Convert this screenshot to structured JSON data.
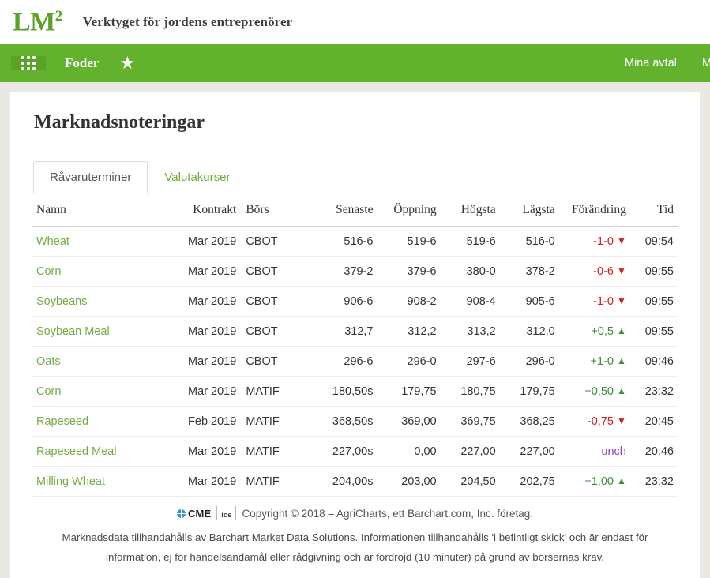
{
  "brand": {
    "logo_text": "LM",
    "logo_sup": "2",
    "tagline": "Verktyget för jordens entreprenörer"
  },
  "nav": {
    "grid_icon": "grid-apps-icon",
    "title": "Foder",
    "star_icon": "star-icon",
    "star_glyph": "★",
    "links": [
      {
        "label": "Mina avtal"
      },
      {
        "label": "M"
      }
    ]
  },
  "main": {
    "title": "Marknadsnoteringar",
    "tabs": [
      {
        "label": "Råvaruterminer",
        "active": true
      },
      {
        "label": "Valutakurser",
        "active": false
      }
    ],
    "table": {
      "headers": [
        "Namn",
        "Kontrakt",
        "Börs",
        "Senaste",
        "Öppning",
        "Högsta",
        "Lägsta",
        "Förändring",
        "Tid"
      ],
      "rows": [
        {
          "namn": "Wheat",
          "kontrakt": "Mar 2019",
          "bors": "CBOT",
          "senaste": "516-6",
          "oppning": "519-6",
          "hogsta": "519-6",
          "lagsta": "516-0",
          "forandring": "-1-0",
          "direction": "down",
          "arrow": "▼",
          "tid": "09:54"
        },
        {
          "namn": "Corn",
          "kontrakt": "Mar 2019",
          "bors": "CBOT",
          "senaste": "379-2",
          "oppning": "379-6",
          "hogsta": "380-0",
          "lagsta": "378-2",
          "forandring": "-0-6",
          "direction": "down",
          "arrow": "▼",
          "tid": "09:55"
        },
        {
          "namn": "Soybeans",
          "kontrakt": "Mar 2019",
          "bors": "CBOT",
          "senaste": "906-6",
          "oppning": "908-2",
          "hogsta": "908-4",
          "lagsta": "905-6",
          "forandring": "-1-0",
          "direction": "down",
          "arrow": "▼",
          "tid": "09:55"
        },
        {
          "namn": "Soybean Meal",
          "kontrakt": "Mar 2019",
          "bors": "CBOT",
          "senaste": "312,7",
          "oppning": "312,2",
          "hogsta": "313,2",
          "lagsta": "312,0",
          "forandring": "+0,5",
          "direction": "up",
          "arrow": "▲",
          "tid": "09:55"
        },
        {
          "namn": "Oats",
          "kontrakt": "Mar 2019",
          "bors": "CBOT",
          "senaste": "296-6",
          "oppning": "296-0",
          "hogsta": "297-6",
          "lagsta": "296-0",
          "forandring": "+1-0",
          "direction": "up",
          "arrow": "▲",
          "tid": "09:46"
        },
        {
          "namn": "Corn",
          "kontrakt": "Mar 2019",
          "bors": "MATIF",
          "senaste": "180,50s",
          "oppning": "179,75",
          "hogsta": "180,75",
          "lagsta": "179,75",
          "forandring": "+0,50",
          "direction": "up",
          "arrow": "▲",
          "tid": "23:32"
        },
        {
          "namn": "Rapeseed",
          "kontrakt": "Feb 2019",
          "bors": "MATIF",
          "senaste": "368,50s",
          "oppning": "369,00",
          "hogsta": "369,75",
          "lagsta": "368,25",
          "forandring": "-0,75",
          "direction": "down",
          "arrow": "▼",
          "tid": "20:45"
        },
        {
          "namn": "Rapeseed Meal",
          "kontrakt": "Mar 2019",
          "bors": "MATIF",
          "senaste": "227,00s",
          "oppning": "0,00",
          "hogsta": "227,00",
          "lagsta": "227,00",
          "forandring": "unch",
          "direction": "unch",
          "arrow": "",
          "tid": "20:46"
        },
        {
          "namn": "Milling Wheat",
          "kontrakt": "Mar 2019",
          "bors": "MATIF",
          "senaste": "204,00s",
          "oppning": "203,00",
          "hogsta": "204,50",
          "lagsta": "202,75",
          "forandring": "+1,00",
          "direction": "up",
          "arrow": "▲",
          "tid": "23:32"
        }
      ]
    }
  },
  "footer": {
    "cme_label": "CME",
    "ice_label": "ice",
    "copyright": "Copyright © 2018 – AgriCharts, ett Barchart.com, Inc. företag.",
    "disclaimer": "Marknadsdata tillhandahålls av Barchart Market Data Solutions. Informationen tillhandahålls 'i befintligt skick' och är endast för information, ej för handelsändamål eller rådgivning och är fördröjd (10 minuter) på grund av börsernas krav."
  },
  "colors": {
    "nav_green": "#62b22e",
    "brand_green": "#5aa327",
    "link_green": "#74ab45",
    "up": "#3c8d36",
    "down": "#cc2222",
    "unch": "#8e44c0",
    "page_bg": "#eae8e3"
  }
}
